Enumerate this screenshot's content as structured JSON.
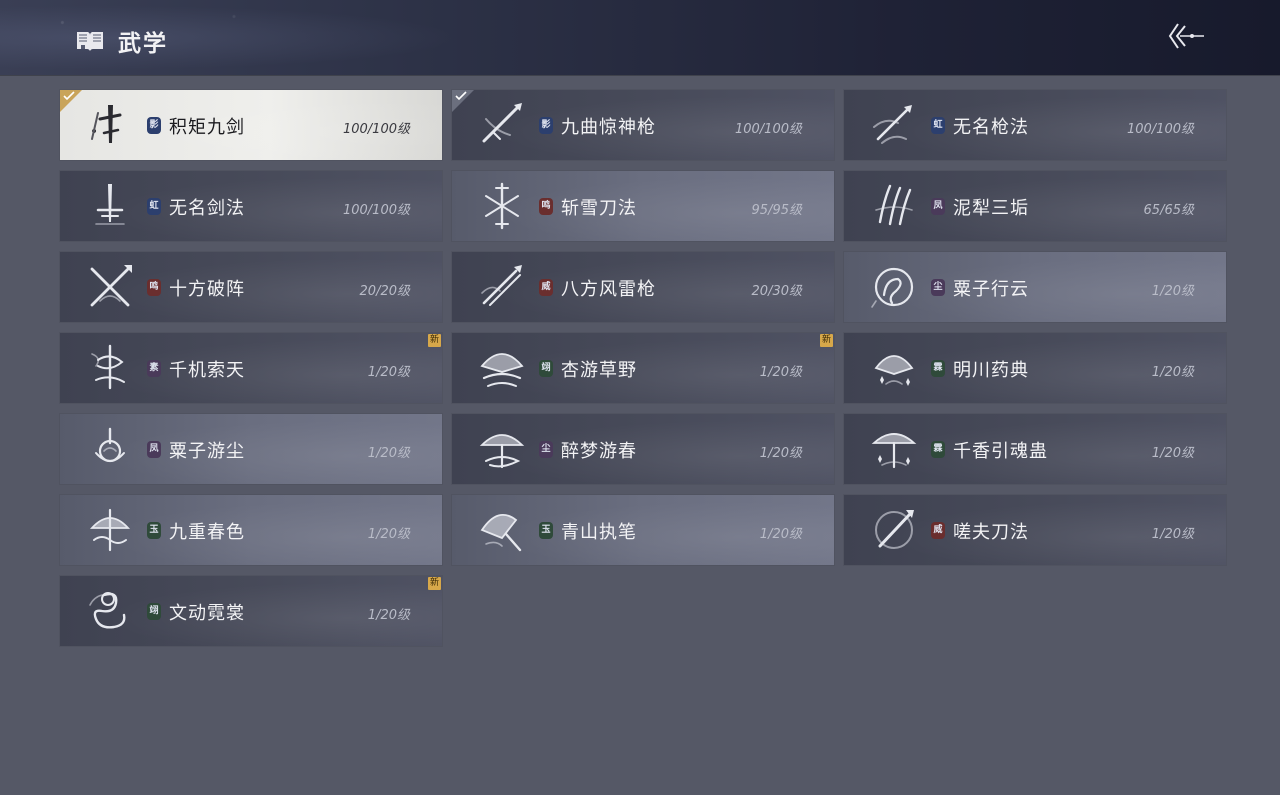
{
  "header": {
    "title": "武学",
    "book_icon": "book-icon",
    "back_icon": "back-arrow-icon"
  },
  "colors": {
    "new_tag": "#d7a84a",
    "selected_check": "#c9a45a",
    "badge_blue": "#2c3f6e",
    "badge_red": "#6a2e2e",
    "badge_purple": "#4a3a5a",
    "badge_green": "#2f4a3a"
  },
  "skills": [
    {
      "name": "积矩九剑",
      "badge": "影",
      "badge_color": "blue",
      "level": "100/100级",
      "icon": "sword-ink-icon",
      "selected": true,
      "checked": true,
      "new": false,
      "tone": "selected"
    },
    {
      "name": "九曲惊神枪",
      "badge": "影",
      "badge_color": "blue",
      "level": "100/100级",
      "icon": "spear-cross-icon",
      "selected": false,
      "checked": true,
      "new": false,
      "tone": "dark"
    },
    {
      "name": "无名枪法",
      "badge": "虹",
      "badge_color": "blue",
      "level": "100/100级",
      "icon": "spear-slash-icon",
      "selected": false,
      "checked": false,
      "new": false,
      "tone": "dark"
    },
    {
      "name": "无名剑法",
      "badge": "虹",
      "badge_color": "blue",
      "level": "100/100级",
      "icon": "sword-upright-icon",
      "selected": false,
      "checked": false,
      "new": false,
      "tone": "dark"
    },
    {
      "name": "斩雪刀法",
      "badge": "鸣",
      "badge_color": "red",
      "level": "95/95级",
      "icon": "snowflake-blade-icon",
      "selected": false,
      "checked": false,
      "new": false,
      "tone": "alt"
    },
    {
      "name": "泥犁三垢",
      "badge": "凤",
      "badge_color": "purple",
      "level": "65/65级",
      "icon": "triple-claw-icon",
      "selected": false,
      "checked": false,
      "new": false,
      "tone": "dark"
    },
    {
      "name": "十方破阵",
      "badge": "鸣",
      "badge_color": "red",
      "level": "20/20级",
      "icon": "crossed-blades-icon",
      "selected": false,
      "checked": false,
      "new": false,
      "tone": "dark"
    },
    {
      "name": "八方风雷枪",
      "badge": "威",
      "badge_color": "red",
      "level": "20/30级",
      "icon": "wind-spear-icon",
      "selected": false,
      "checked": false,
      "new": false,
      "tone": "dark"
    },
    {
      "name": "粟子行云",
      "badge": "尘",
      "badge_color": "purple",
      "level": "1/20级",
      "icon": "cloud-swirl-icon",
      "selected": false,
      "checked": false,
      "new": false,
      "tone": "alt"
    },
    {
      "name": "千机索天",
      "badge": "素",
      "badge_color": "purple",
      "level": "1/20级",
      "icon": "chain-whip-icon",
      "selected": false,
      "checked": false,
      "new": true,
      "tone": "dark"
    },
    {
      "name": "杏游草野",
      "badge": "翊",
      "badge_color": "green",
      "level": "1/20级",
      "icon": "fan-wind-icon",
      "selected": false,
      "checked": false,
      "new": true,
      "tone": "dark"
    },
    {
      "name": "明川药典",
      "badge": "霖",
      "badge_color": "green",
      "level": "1/20级",
      "icon": "fan-sparkle-icon",
      "selected": false,
      "checked": false,
      "new": false,
      "tone": "dark"
    },
    {
      "name": "粟子游尘",
      "badge": "凤",
      "badge_color": "purple",
      "level": "1/20级",
      "icon": "spiral-drop-icon",
      "selected": false,
      "checked": false,
      "new": false,
      "tone": "alt"
    },
    {
      "name": "醉梦游春",
      "badge": "尘",
      "badge_color": "purple",
      "level": "1/20级",
      "icon": "umbrella-swirl-icon",
      "selected": false,
      "checked": false,
      "new": false,
      "tone": "dark"
    },
    {
      "name": "千香引魂蛊",
      "badge": "霖",
      "badge_color": "green",
      "level": "1/20级",
      "icon": "umbrella-sparkle-icon",
      "selected": false,
      "checked": false,
      "new": false,
      "tone": "dark"
    },
    {
      "name": "九重春色",
      "badge": "玉",
      "badge_color": "green",
      "level": "1/20级",
      "icon": "umbrella-wave-icon",
      "selected": false,
      "checked": false,
      "new": false,
      "tone": "alt"
    },
    {
      "name": "青山执笔",
      "badge": "玉",
      "badge_color": "green",
      "level": "1/20级",
      "icon": "fan-brush-icon",
      "selected": false,
      "checked": false,
      "new": false,
      "tone": "alt"
    },
    {
      "name": "嗟夫刀法",
      "badge": "威",
      "badge_color": "red",
      "level": "1/20级",
      "icon": "circle-blade-icon",
      "selected": false,
      "checked": false,
      "new": false,
      "tone": "dark"
    },
    {
      "name": "文动霓裳",
      "badge": "翊",
      "badge_color": "green",
      "level": "1/20级",
      "icon": "ribbon-dance-icon",
      "selected": false,
      "checked": false,
      "new": true,
      "tone": "dark"
    }
  ],
  "new_label": "新"
}
